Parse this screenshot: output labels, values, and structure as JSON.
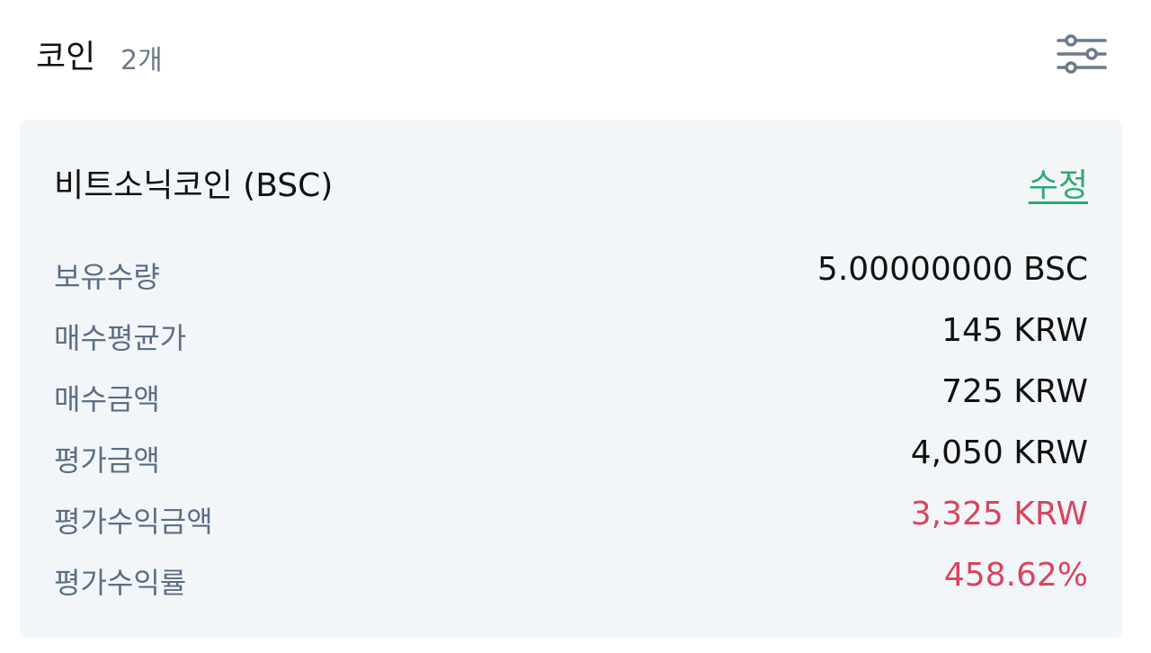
{
  "header": {
    "title": "코인",
    "count": "2개",
    "filter_icon": "sliders-icon"
  },
  "card": {
    "title": "비트소닉코인 (BSC)",
    "edit_label": "수정",
    "rows": [
      {
        "label": "보유수량",
        "value": "5.00000000 BSC"
      },
      {
        "label": "매수평균가",
        "value": "145 KRW"
      },
      {
        "label": "매수금액",
        "value": "725 KRW"
      },
      {
        "label": "평가금액",
        "value": "4,050 KRW"
      },
      {
        "label": "평가수익금액",
        "value": "3,325 KRW"
      },
      {
        "label": "평가수익률",
        "value": "458.62%"
      }
    ]
  },
  "colors": {
    "accent_green": "#2eaa73",
    "profit_red": "#d9445f",
    "label_gray": "#5a6e84",
    "card_bg": "#f3f6f9"
  }
}
